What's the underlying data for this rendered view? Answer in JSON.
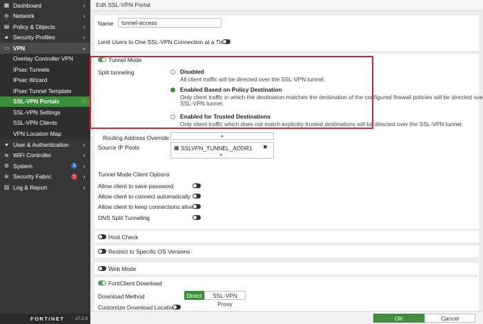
{
  "sidebar": {
    "dashboard": "Dashboard",
    "network": "Network",
    "policy": "Policy & Objects",
    "security_profiles": "Security Profiles",
    "vpn": "VPN",
    "vpn_items": [
      "Overlay Controller VPN",
      "IPsec Tunnels",
      "IPsec Wizard",
      "IPsec Tunnel Template",
      "SSL-VPN Portals",
      "SSL-VPN Settings",
      "SSL-VPN Clients",
      "VPN Location Map"
    ],
    "user_auth": "User & Authentication",
    "wifi": "WiFi Controller",
    "system": "System",
    "system_badge": "1",
    "security_fabric": "Security Fabric",
    "fabric_badge": "1",
    "log_report": "Log & Report",
    "logo": "FORTINET",
    "version": "v7.2.9"
  },
  "page": {
    "title": "Edit SSL-VPN Portal"
  },
  "form": {
    "name_label": "Name",
    "name_value": "tunnel-access",
    "limit_label": "Limit Users to One SSL-VPN Connection at a Time",
    "tunnel_mode": "Tunnel Mode",
    "split_label": "Split tunneling",
    "opt_disabled": "Disabled",
    "opt_disabled_desc": "All client traffic will be directed over the SSL-VPN tunnel.",
    "opt_policy": "Enabled Based on Policy Destination",
    "opt_policy_desc1": "Only client traffic in which the destination matches the destination of the configured firewall policies will be directed over the",
    "opt_policy_desc2": "SSL-VPN tunnel.",
    "opt_trusted": "Enabled for Trusted Destinations",
    "opt_trusted_desc": "Only client traffic which does not match explicitly trusted destinations will be directed over the SSL-VPN tunnel.",
    "routing_label": "Routing Address Override",
    "source_pools_label": "Source IP Pools",
    "source_pool_value": "SSLVPN_TUNNEL_ADDR1",
    "client_options_header": "Tunnel Mode Client Options",
    "save_password": "Allow client to save password",
    "connect_auto": "Allow client to connect automatically",
    "keep_alive": "Allow client to keep connections alive",
    "dns_split": "DNS Split Tunneling",
    "host_check": "Host Check",
    "restrict_os": "Restrict to Specific OS Versions",
    "web_mode": "Web Mode",
    "forticlient_download": "FortiClient Download",
    "download_method_label": "Download Method",
    "download_direct": "Direct",
    "download_proxy": "SSL-VPN Proxy",
    "customize_location": "Customize Download Location"
  },
  "footer": {
    "ok": "OK",
    "cancel": "Cancel"
  },
  "icons": {
    "plus": "+",
    "close": "✖",
    "pool": "▦"
  },
  "colors": {
    "accent": "#3d8f3f",
    "highlight": "#e0202a",
    "sidebar": "#363636"
  }
}
